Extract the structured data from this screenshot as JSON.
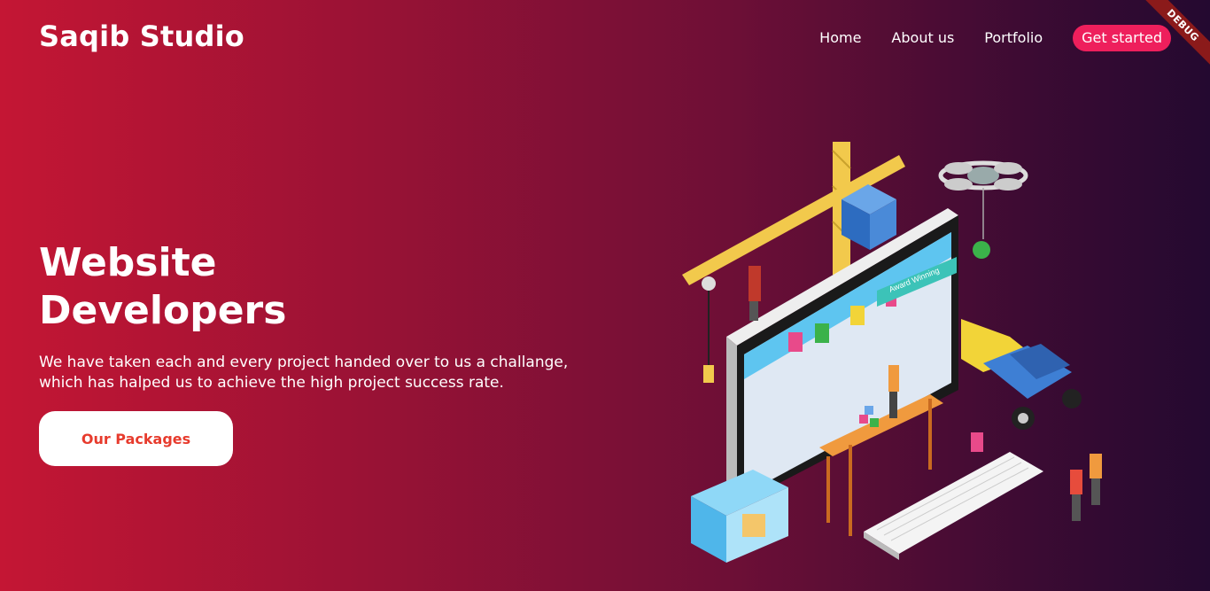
{
  "header": {
    "brand": "Saqib Studio",
    "nav": [
      "Home",
      "About us",
      "Portfolio"
    ],
    "cta": "Get started",
    "debug_badge": "DEBUG"
  },
  "hero": {
    "title_line1": "Website",
    "title_line2": "Developers",
    "description_line1": "We have taken each and every project handed over to us a challange,",
    "description_line2": "which has halped us to achieve the high project success rate.",
    "button_label": "Our Packages"
  },
  "illustration": {
    "sign_text": "Award Winning"
  },
  "colors": {
    "gradient_start": "#c41634",
    "gradient_end": "#240930",
    "cta_bg": "#ee1f5c",
    "button_text": "#e73b2d"
  }
}
